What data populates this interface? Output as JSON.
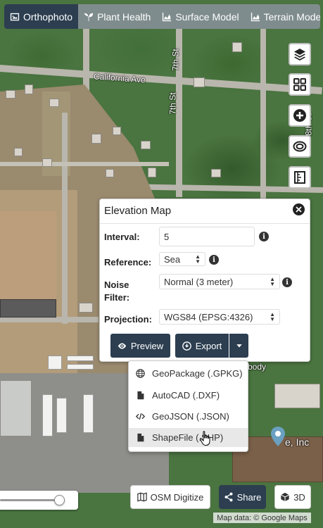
{
  "tabs": [
    {
      "label": "Orthophoto",
      "icon": "image-icon",
      "active": true
    },
    {
      "label": "Plant Health",
      "icon": "seedling-icon",
      "active": false
    },
    {
      "label": "Surface Model",
      "icon": "area-chart-icon",
      "active": false
    },
    {
      "label": "Terrain Model",
      "icon": "area-chart-icon",
      "active": false
    }
  ],
  "map": {
    "street_labels": {
      "california": "California Ave",
      "seventh": "7th St",
      "eighth": "8th St",
      "fragment_1": "body",
      "fragment_2": "e, Inc"
    },
    "attribution": "Map data: © Google Maps"
  },
  "controls": [
    "layers-icon",
    "grid-icon",
    "plus-circle-icon",
    "eye-icon",
    "ruler-icon"
  ],
  "elevation": {
    "title": "Elevation Map",
    "interval_label": "Interval:",
    "interval_value": "5",
    "reference_label": "Reference:",
    "reference_value": "Sea",
    "noise_label_1": "Noise",
    "noise_label_2": "Filter:",
    "noise_value": "Normal (3 meter)",
    "projection_label": "Projection:",
    "projection_value": "WGS84 (EPSG:4326)",
    "preview_label": "Preview",
    "export_label": "Export"
  },
  "export_menu": [
    {
      "label": "GeoPackage (.GPKG)",
      "icon": "globe-icon"
    },
    {
      "label": "AutoCAD (.DXF)",
      "icon": "file-icon"
    },
    {
      "label": "GeoJSON (.JSON)",
      "icon": "code-icon"
    },
    {
      "label": "ShapeFile (.SHP)",
      "icon": "file-icon",
      "hovered": true
    }
  ],
  "bottom": {
    "osm_label": "OSM Digitize",
    "share_label": "Share",
    "three_d_label": "3D",
    "opacity_slider_value": 0.95
  },
  "colors": {
    "navy": "#2c3e50",
    "tab_bar": "#7f8c8d"
  }
}
